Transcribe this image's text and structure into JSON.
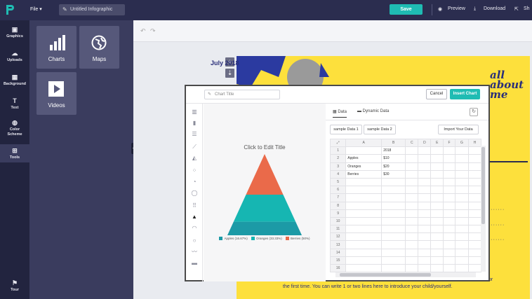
{
  "topbar": {
    "file_label": "File ▾",
    "doc_title": "Untitled Infographic",
    "save_label": "Save",
    "preview_label": "Preview",
    "download_label": "Download",
    "share_label": "Sh"
  },
  "rail": {
    "items": [
      {
        "label": "Graphics",
        "icon": "image-icon"
      },
      {
        "label": "Uploads",
        "icon": "cloud-upload-icon"
      },
      {
        "label": "Background",
        "icon": "background-icon"
      },
      {
        "label": "Text",
        "icon": "text-icon"
      },
      {
        "label": "Color\nScheme",
        "icon": "palette-icon"
      },
      {
        "label": "Tools",
        "icon": "toolbox-icon"
      }
    ],
    "tour_label": "Tour"
  },
  "panel": {
    "tiles": [
      {
        "label": "Charts",
        "icon": "bar-chart-icon"
      },
      {
        "label": "Maps",
        "icon": "globe-icon"
      },
      {
        "label": "Videos",
        "icon": "play-icon"
      }
    ]
  },
  "infographic": {
    "date": "July 2018",
    "all_about": "all about me",
    "footer_line1": "for",
    "footer_line2": "the first time. You can write 1 or two lines here to introduce your child/yourself."
  },
  "modal": {
    "chart_title_placeholder": "Chart Title",
    "cancel_label": "Cancel",
    "insert_label": "Insert Chart",
    "tabs": [
      {
        "label": "Data"
      },
      {
        "label": "Dynamic Data"
      }
    ],
    "sample_buttons": [
      "sample Data 1",
      "sample Data 2"
    ],
    "import_label": "Import Your Data",
    "preview_title": "Click to Edit Title",
    "legend": [
      {
        "label": "Apples (16.67%)",
        "color": "#1c9aa6"
      },
      {
        "label": "Oranges (33.33%)",
        "color": "#16b6b2"
      },
      {
        "label": "Berries (50%)",
        "color": "#ea6a4a"
      }
    ],
    "grid_columns": [
      "A",
      "B",
      "C",
      "D",
      "E",
      "F",
      "G",
      "H"
    ],
    "grid_rows": [
      [
        "",
        "2018"
      ],
      [
        "Apples",
        "$10"
      ],
      [
        "Oranges",
        "$20"
      ],
      [
        "Berries",
        "$30"
      ]
    ],
    "row_count": 16
  },
  "chart_data": {
    "type": "pyramid",
    "title": "Click to Edit Title",
    "categories": [
      "Apples",
      "Oranges",
      "Berries"
    ],
    "series": [
      {
        "name": "2018",
        "values": [
          10,
          20,
          30
        ]
      }
    ],
    "percentages": [
      16.67,
      33.33,
      50
    ],
    "colors": [
      "#1c9aa6",
      "#16b6b2",
      "#ea6a4a"
    ]
  },
  "colors": {
    "accent": "#1fbcb3",
    "topbar": "#2b2d4f",
    "rail": "#22243f",
    "panel": "#3a3c5e",
    "page": "#fde03c"
  }
}
